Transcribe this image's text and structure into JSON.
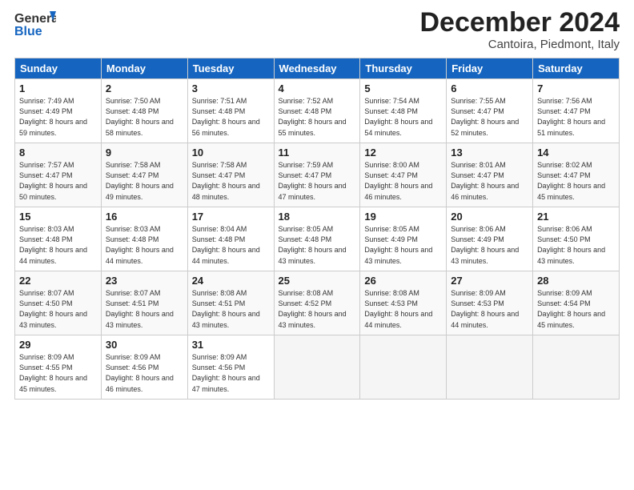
{
  "logo": {
    "general": "General",
    "blue": "Blue"
  },
  "header": {
    "month": "December 2024",
    "location": "Cantoira, Piedmont, Italy"
  },
  "weekdays": [
    "Sunday",
    "Monday",
    "Tuesday",
    "Wednesday",
    "Thursday",
    "Friday",
    "Saturday"
  ],
  "weeks": [
    [
      {
        "day": 1,
        "sunrise": "7:49 AM",
        "sunset": "4:49 PM",
        "daylight": "8 hours and 59 minutes."
      },
      {
        "day": 2,
        "sunrise": "7:50 AM",
        "sunset": "4:48 PM",
        "daylight": "8 hours and 58 minutes."
      },
      {
        "day": 3,
        "sunrise": "7:51 AM",
        "sunset": "4:48 PM",
        "daylight": "8 hours and 56 minutes."
      },
      {
        "day": 4,
        "sunrise": "7:52 AM",
        "sunset": "4:48 PM",
        "daylight": "8 hours and 55 minutes."
      },
      {
        "day": 5,
        "sunrise": "7:54 AM",
        "sunset": "4:48 PM",
        "daylight": "8 hours and 54 minutes."
      },
      {
        "day": 6,
        "sunrise": "7:55 AM",
        "sunset": "4:47 PM",
        "daylight": "8 hours and 52 minutes."
      },
      {
        "day": 7,
        "sunrise": "7:56 AM",
        "sunset": "4:47 PM",
        "daylight": "8 hours and 51 minutes."
      }
    ],
    [
      {
        "day": 8,
        "sunrise": "7:57 AM",
        "sunset": "4:47 PM",
        "daylight": "8 hours and 50 minutes."
      },
      {
        "day": 9,
        "sunrise": "7:58 AM",
        "sunset": "4:47 PM",
        "daylight": "8 hours and 49 minutes."
      },
      {
        "day": 10,
        "sunrise": "7:58 AM",
        "sunset": "4:47 PM",
        "daylight": "8 hours and 48 minutes."
      },
      {
        "day": 11,
        "sunrise": "7:59 AM",
        "sunset": "4:47 PM",
        "daylight": "8 hours and 47 minutes."
      },
      {
        "day": 12,
        "sunrise": "8:00 AM",
        "sunset": "4:47 PM",
        "daylight": "8 hours and 46 minutes."
      },
      {
        "day": 13,
        "sunrise": "8:01 AM",
        "sunset": "4:47 PM",
        "daylight": "8 hours and 46 minutes."
      },
      {
        "day": 14,
        "sunrise": "8:02 AM",
        "sunset": "4:47 PM",
        "daylight": "8 hours and 45 minutes."
      }
    ],
    [
      {
        "day": 15,
        "sunrise": "8:03 AM",
        "sunset": "4:48 PM",
        "daylight": "8 hours and 44 minutes."
      },
      {
        "day": 16,
        "sunrise": "8:03 AM",
        "sunset": "4:48 PM",
        "daylight": "8 hours and 44 minutes."
      },
      {
        "day": 17,
        "sunrise": "8:04 AM",
        "sunset": "4:48 PM",
        "daylight": "8 hours and 44 minutes."
      },
      {
        "day": 18,
        "sunrise": "8:05 AM",
        "sunset": "4:48 PM",
        "daylight": "8 hours and 43 minutes."
      },
      {
        "day": 19,
        "sunrise": "8:05 AM",
        "sunset": "4:49 PM",
        "daylight": "8 hours and 43 minutes."
      },
      {
        "day": 20,
        "sunrise": "8:06 AM",
        "sunset": "4:49 PM",
        "daylight": "8 hours and 43 minutes."
      },
      {
        "day": 21,
        "sunrise": "8:06 AM",
        "sunset": "4:50 PM",
        "daylight": "8 hours and 43 minutes."
      }
    ],
    [
      {
        "day": 22,
        "sunrise": "8:07 AM",
        "sunset": "4:50 PM",
        "daylight": "8 hours and 43 minutes."
      },
      {
        "day": 23,
        "sunrise": "8:07 AM",
        "sunset": "4:51 PM",
        "daylight": "8 hours and 43 minutes."
      },
      {
        "day": 24,
        "sunrise": "8:08 AM",
        "sunset": "4:51 PM",
        "daylight": "8 hours and 43 minutes."
      },
      {
        "day": 25,
        "sunrise": "8:08 AM",
        "sunset": "4:52 PM",
        "daylight": "8 hours and 43 minutes."
      },
      {
        "day": 26,
        "sunrise": "8:08 AM",
        "sunset": "4:53 PM",
        "daylight": "8 hours and 44 minutes."
      },
      {
        "day": 27,
        "sunrise": "8:09 AM",
        "sunset": "4:53 PM",
        "daylight": "8 hours and 44 minutes."
      },
      {
        "day": 28,
        "sunrise": "8:09 AM",
        "sunset": "4:54 PM",
        "daylight": "8 hours and 45 minutes."
      }
    ],
    [
      {
        "day": 29,
        "sunrise": "8:09 AM",
        "sunset": "4:55 PM",
        "daylight": "8 hours and 45 minutes."
      },
      {
        "day": 30,
        "sunrise": "8:09 AM",
        "sunset": "4:56 PM",
        "daylight": "8 hours and 46 minutes."
      },
      {
        "day": 31,
        "sunrise": "8:09 AM",
        "sunset": "4:56 PM",
        "daylight": "8 hours and 47 minutes."
      },
      null,
      null,
      null,
      null
    ]
  ]
}
